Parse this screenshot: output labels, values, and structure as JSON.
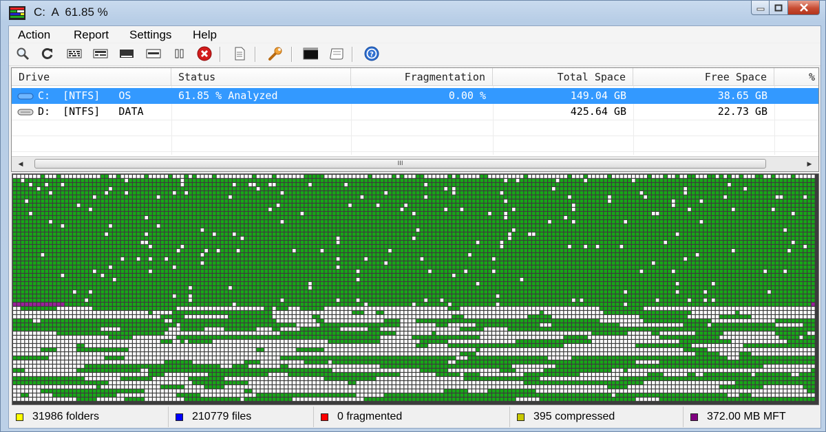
{
  "window": {
    "title": "C:  A  61.85 %"
  },
  "menu": [
    {
      "label": "Action"
    },
    {
      "label": "Report"
    },
    {
      "label": "Settings"
    },
    {
      "label": "Help"
    }
  ],
  "toolbar": {
    "buttons": [
      {
        "icon": "magnifier-icon"
      },
      {
        "icon": "refresh-icon"
      },
      {
        "icon": "defrag-icon"
      },
      {
        "icon": "quick-optimize-icon"
      },
      {
        "icon": "full-optimize-icon"
      },
      {
        "icon": "mft-optimize-icon"
      },
      {
        "icon": "pause-icon"
      },
      {
        "icon": "stop-icon"
      },
      {
        "icon": "report-icon"
      },
      {
        "icon": "wrench-icon"
      },
      {
        "icon": "console-icon"
      },
      {
        "icon": "boot-time-icon"
      },
      {
        "icon": "help-icon"
      }
    ]
  },
  "drives": {
    "columns": [
      "Drive",
      "Status",
      "Fragmentation",
      "Total Space",
      "Free Space",
      "% "
    ],
    "rows": [
      {
        "drive": "C:  [NTFS]   OS",
        "status": "61.85 % Analyzed",
        "fragmentation": "0.00 %",
        "total": "149.04 GB",
        "free": "38.65 GB",
        "selected": true
      },
      {
        "drive": "D:  [NTFS]   DATA",
        "status": "",
        "fragmentation": "",
        "total": "425.64 GB",
        "free": "22.73 GB",
        "selected": false
      }
    ],
    "scroll_grip": "III"
  },
  "cluster_map": {
    "legend_colors": {
      "used": "#17a717",
      "free": "#ffffff",
      "mft": "#9b1f9b",
      "grid": "#3c3c3c"
    }
  },
  "status": {
    "items": [
      {
        "color": "#ffff00",
        "text": "31986 folders"
      },
      {
        "color": "#0000ff",
        "text": "210779 files"
      },
      {
        "color": "#ff0000",
        "text": "0 fragmented"
      },
      {
        "color": "#c8c800",
        "text": "395 compressed"
      },
      {
        "color": "#800080",
        "text": "372.00 MB MFT"
      }
    ]
  }
}
